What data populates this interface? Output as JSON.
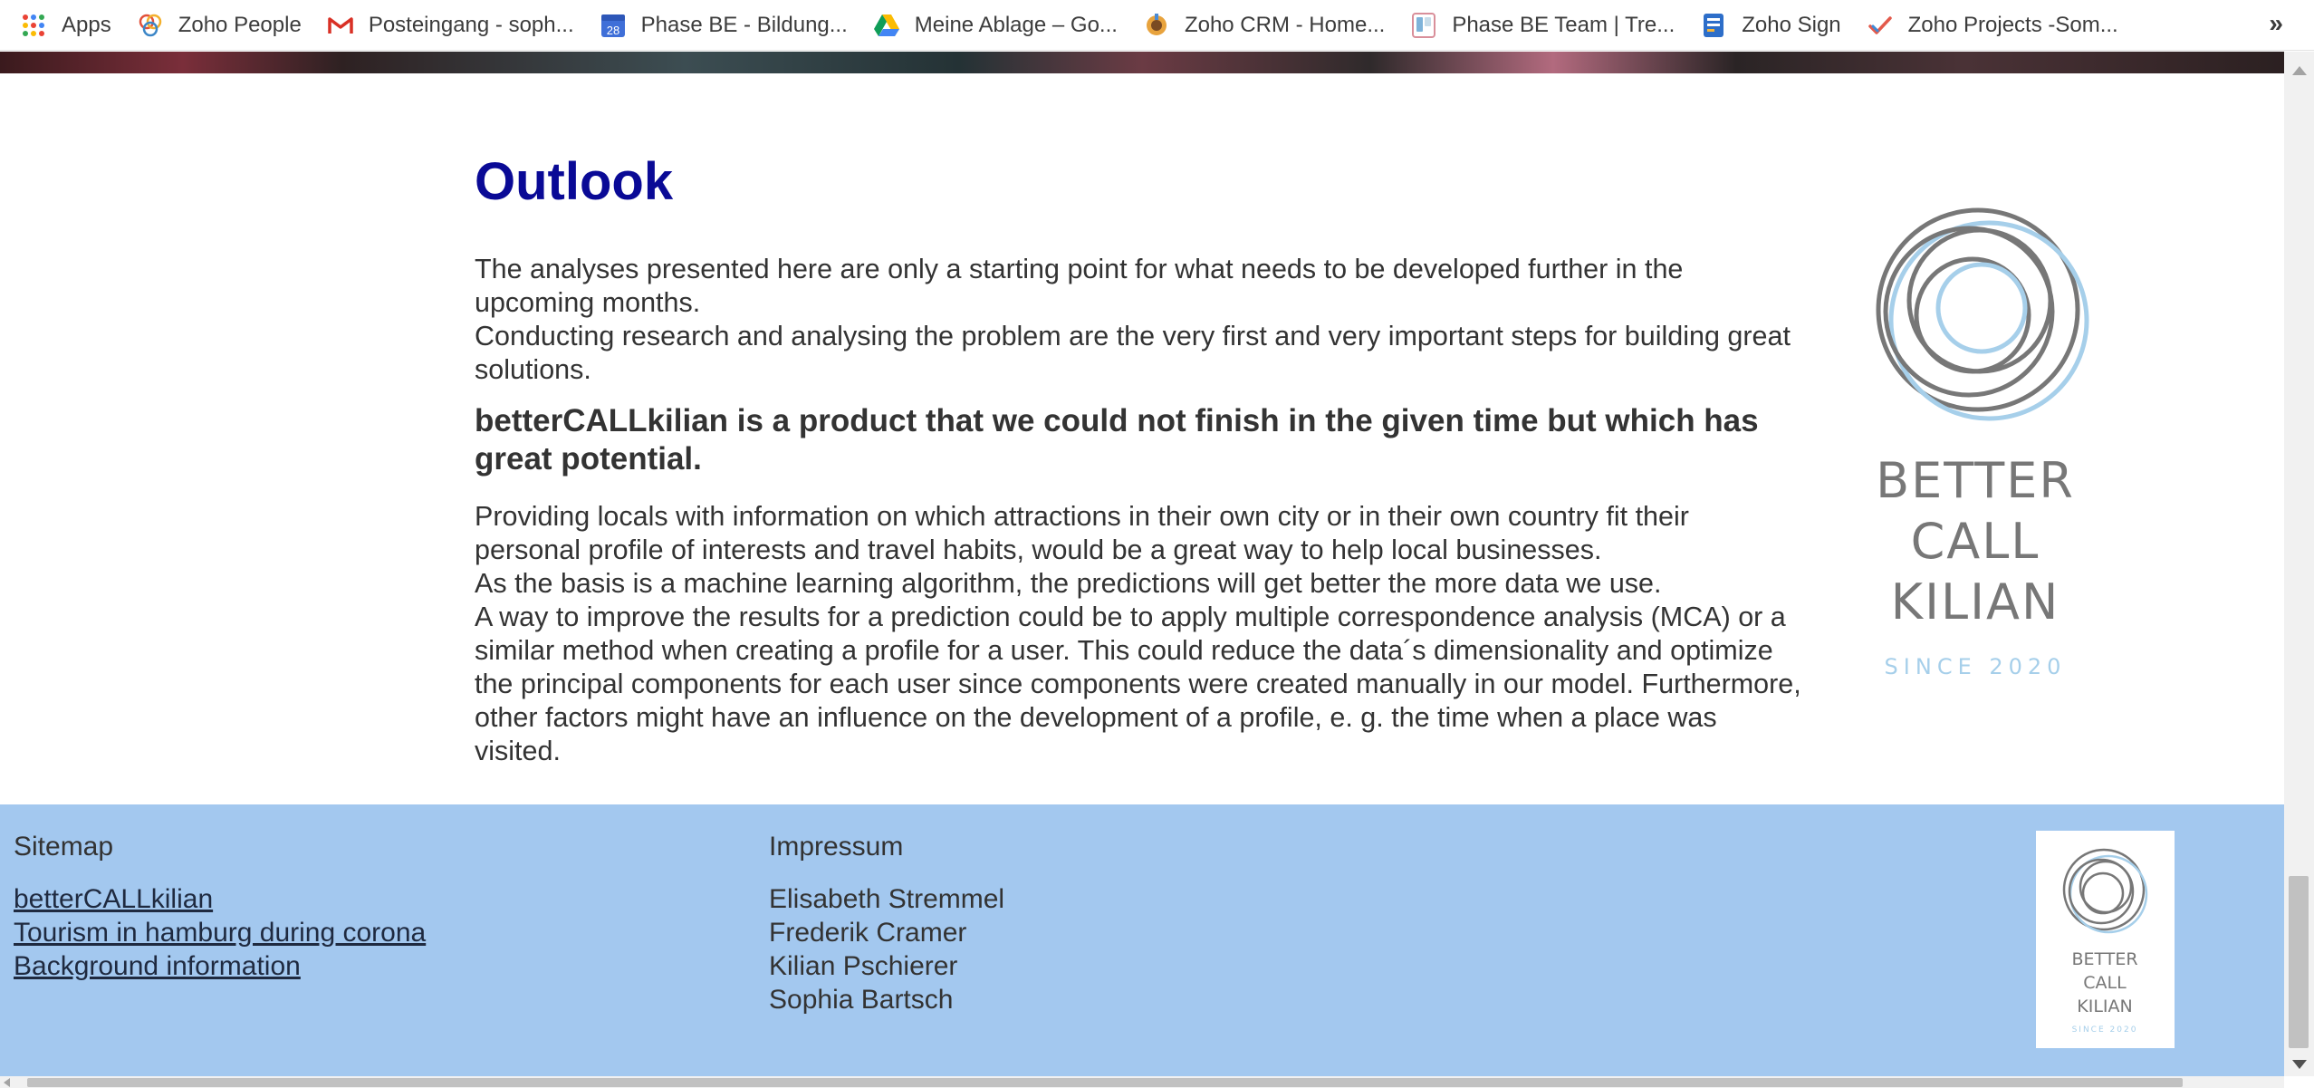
{
  "bookmarks": {
    "items": [
      {
        "label": "Apps",
        "icon": "apps-grid-icon"
      },
      {
        "label": "Zoho People",
        "icon": "zoho-people-icon"
      },
      {
        "label": "Posteingang - soph...",
        "icon": "gmail-icon"
      },
      {
        "label": "Phase BE - Bildung...",
        "icon": "calendar-icon",
        "icon_text": "28"
      },
      {
        "label": "Meine Ablage – Go...",
        "icon": "google-drive-icon"
      },
      {
        "label": "Zoho CRM - Home...",
        "icon": "zoho-crm-icon"
      },
      {
        "label": "Phase BE Team | Tre...",
        "icon": "trello-icon"
      },
      {
        "label": "Zoho Sign",
        "icon": "zoho-sign-icon"
      },
      {
        "label": "Zoho Projects -Som...",
        "icon": "zoho-projects-icon"
      }
    ],
    "overflow_label": "»"
  },
  "content": {
    "title": "Outlook",
    "paragraph1_line1": "The analyses presented here are only a starting point for what needs to be developed further in the upcoming months.",
    "paragraph1_line2": "Conducting research and analysing the problem are the very first and very important steps for building great solutions.",
    "bold_statement": "betterCALLkilian is a product that we could not finish in the given time but which has great potential.",
    "paragraph2_line1": "Providing locals with information on which attractions in their own city or in their own country fit their personal profile of interests and travel habits, would be a great way to help local businesses.",
    "paragraph2_line2": "As the basis is a machine learning algorithm, the predictions will get better the more data we use.",
    "paragraph2_line3": "A way to improve the results for a prediction could be to apply multiple correspondence analysis (MCA) or a similar method when creating a profile for a user. This could reduce the data´s dimensionality and optimize the principal components for each user since components were created manually in our model. Furthermore, other factors might have an influence on the development of a profile, e. g. the time when a place was visited."
  },
  "logo": {
    "line1": "BETTER",
    "line2": "CALL",
    "line3": "KILIAN",
    "tagline": "SINCE 2020"
  },
  "footer": {
    "sitemap_title": "Sitemap",
    "sitemap_links": [
      "betterCALLkilian",
      "Tourism in hamburg during corona",
      "Background information"
    ],
    "impressum_title": "Impressum",
    "impressum_names": [
      "Elisabeth Stremmel",
      "Frederik Cramer",
      "Kilian Pschierer",
      "Sophia Bartsch"
    ]
  },
  "colors": {
    "title": "#0a0a96",
    "footer_bg": "#a3c8ef",
    "text": "#333333",
    "logo_gray": "#777777",
    "logo_blue": "#a6cfea"
  }
}
